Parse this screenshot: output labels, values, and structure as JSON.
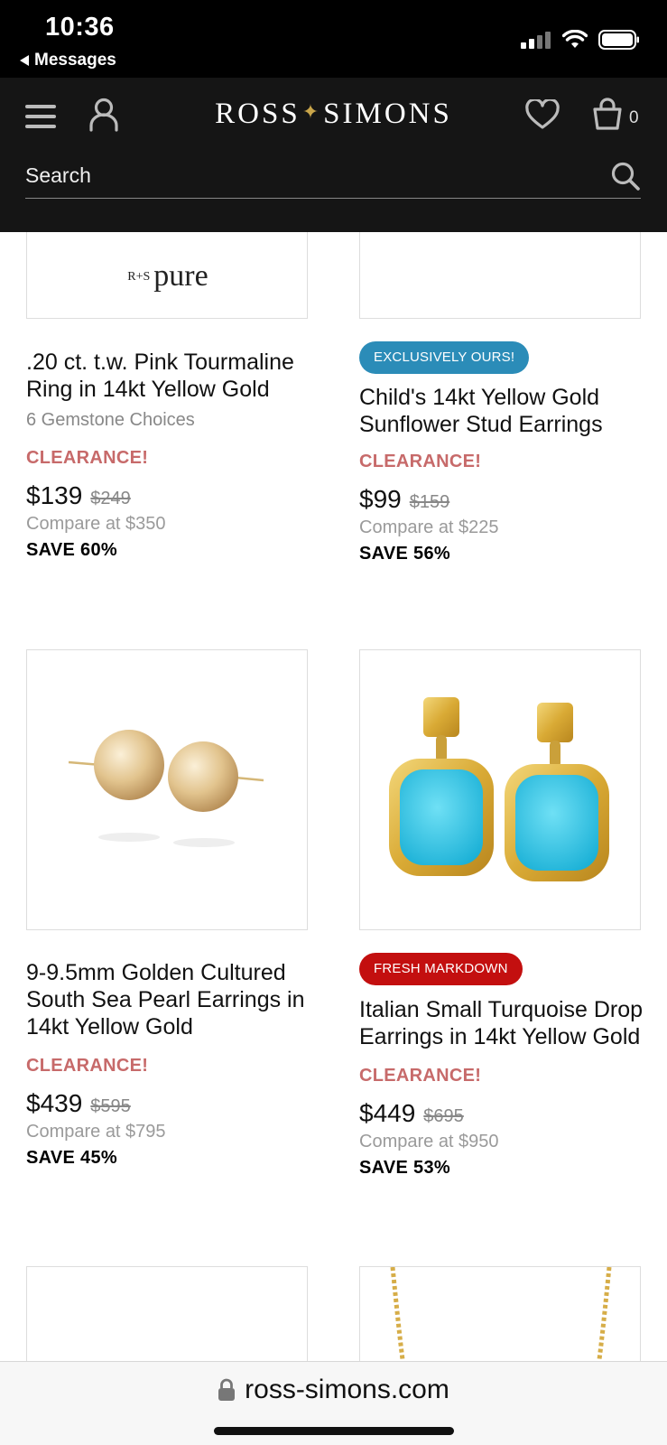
{
  "status_bar": {
    "time": "10:36",
    "back_label": "Messages"
  },
  "header": {
    "logo": "Ross-Simons",
    "logo_left": "ROSS",
    "logo_right": "SIMONS",
    "bag_count": "0",
    "search_placeholder": "Search"
  },
  "top_partial_card": {
    "brand_mark": "R+S pure",
    "brand_small": "R+S",
    "brand_word": "pure"
  },
  "products": [
    {
      "badge": "",
      "title": ".20 ct. t.w. Pink Tourmaline Ring in 14kt Yellow Gold",
      "variants": "6 Gemstone Choices",
      "clearance": "CLEARANCE!",
      "price": "$139",
      "old_price": "$249",
      "compare": "Compare at $350",
      "save": "SAVE 60%"
    },
    {
      "badge": "EXCLUSIVELY OURS!",
      "badge_color": "#2b8cb8",
      "title": "Child's 14kt Yellow Gold Sunflower Stud Earrings",
      "variants": "",
      "clearance": "CLEARANCE!",
      "price": "$99",
      "old_price": "$159",
      "compare": "Compare at $225",
      "save": "SAVE 56%"
    },
    {
      "badge": "",
      "title": "9-9.5mm Golden Cultured South Sea Pearl Earrings in 14kt Yellow Gold",
      "variants": "",
      "clearance": "CLEARANCE!",
      "price": "$439",
      "old_price": "$595",
      "compare": "Compare at $795",
      "save": "SAVE 45%"
    },
    {
      "badge": "FRESH MARKDOWN",
      "badge_color": "#c30f0f",
      "title": "Italian Small Turquoise Drop Earrings in 14kt Yellow Gold",
      "variants": "",
      "clearance": "CLEARANCE!",
      "price": "$449",
      "old_price": "$695",
      "compare": "Compare at $950",
      "save": "SAVE 53%"
    }
  ],
  "url_bar": {
    "url": "ross-simons.com"
  },
  "colors": {
    "header_bg": "#151515",
    "clearance": "#c76a6a",
    "gold": "#c9a54a"
  }
}
